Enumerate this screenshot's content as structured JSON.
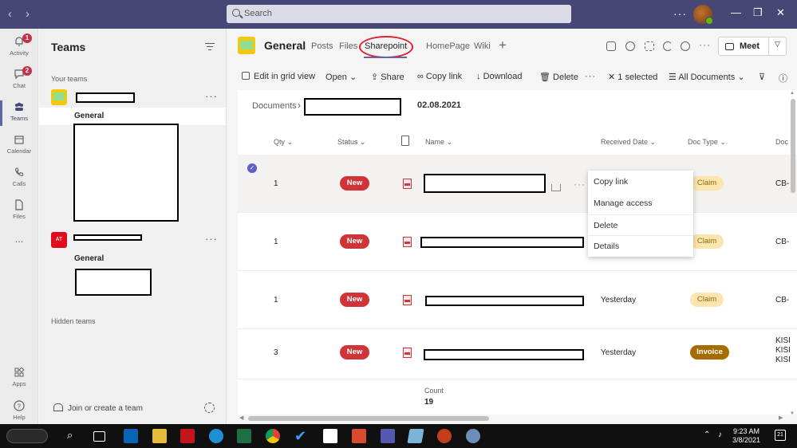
{
  "titlebar": {
    "search_placeholder": "Search"
  },
  "rail": {
    "items": [
      {
        "label": "Activity",
        "badge": "1"
      },
      {
        "label": "Chat",
        "badge": "2"
      },
      {
        "label": "Teams"
      },
      {
        "label": "Calendar"
      },
      {
        "label": "Calls"
      },
      {
        "label": "Files"
      },
      {
        "label": "..."
      },
      {
        "label": "Apps"
      },
      {
        "label": "Help"
      }
    ]
  },
  "teams_panel": {
    "title": "Teams",
    "your_teams": "Your teams",
    "team1_channel": "General",
    "team2_initials": "AT",
    "team2_channel": "General",
    "hidden_teams": "Hidden teams",
    "join_create": "Join or create a team"
  },
  "channel": {
    "name": "General",
    "tabs": [
      "Posts",
      "Files",
      "Sharepoint",
      "HomePage",
      "Wiki"
    ],
    "meet_label": "Meet"
  },
  "commands": {
    "edit_grid": "Edit in grid view",
    "open": "Open",
    "share": "Share",
    "copy_link": "Copy link",
    "download": "Download",
    "delete": "Delete",
    "selected": "1 selected",
    "view": "All Documents"
  },
  "breadcrumb": {
    "root": "Documents",
    "current": "02.08.2021"
  },
  "columns": {
    "qty": "Qty",
    "status": "Status",
    "name": "Name",
    "received_date": "Received Date",
    "doc_type": "Doc Type",
    "doc_cut": "Doc"
  },
  "rows": [
    {
      "qty": "1",
      "status": "New",
      "received_date": "",
      "doc_type": "Claim",
      "doc_cut": "CB-"
    },
    {
      "qty": "1",
      "status": "New",
      "received_date": "",
      "doc_type": "Claim",
      "doc_cut": "CB-"
    },
    {
      "qty": "1",
      "status": "New",
      "received_date": "Yesterday",
      "doc_type": "Claim",
      "doc_cut": "CB-"
    },
    {
      "qty": "3",
      "status": "New",
      "received_date": "Yesterday",
      "doc_type": "Invoice",
      "doc_cut": "KISI KISI KISI"
    }
  ],
  "footer": {
    "count_label": "Count",
    "count_value": "19"
  },
  "context_menu": {
    "items": [
      "Copy link",
      "Manage access",
      "Delete",
      "Details"
    ]
  },
  "taskbar": {
    "time": "9:23 AM",
    "date": "3/8/2021",
    "notifications": "21"
  }
}
